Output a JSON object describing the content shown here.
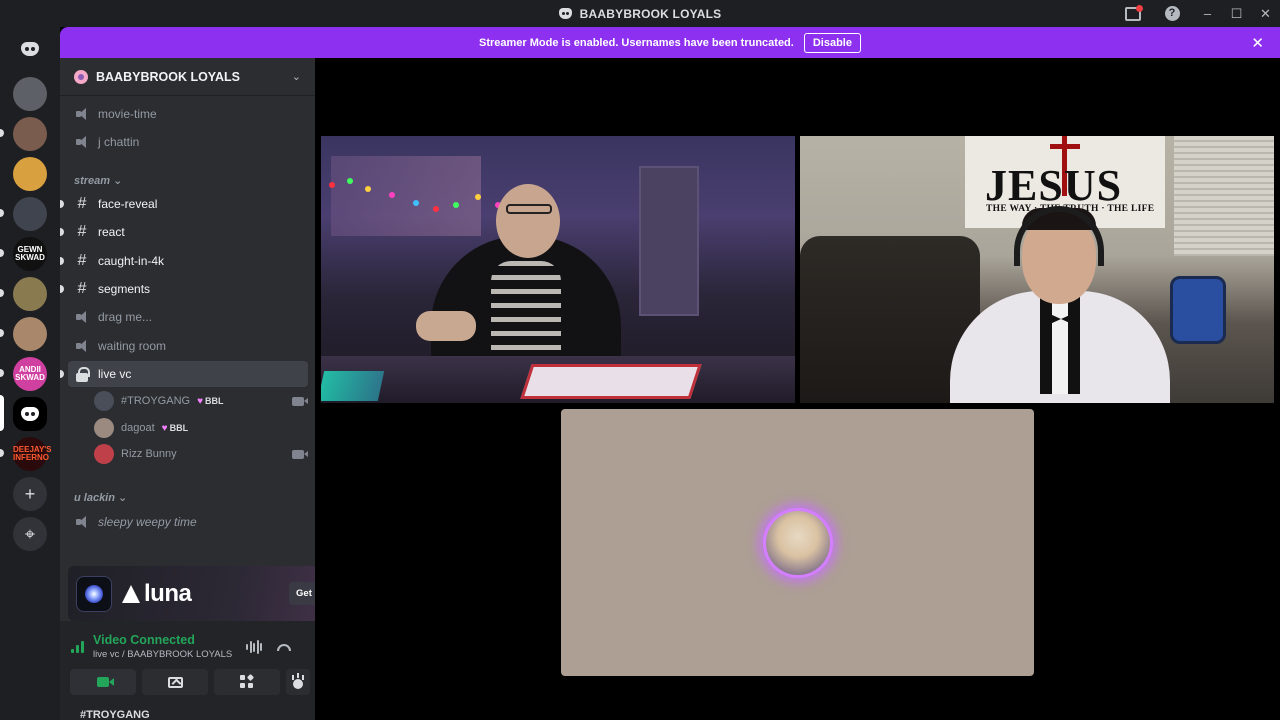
{
  "window": {
    "title": "BAABYBROOK LOYALS",
    "controls": {
      "minimize": "–",
      "maximize": "☐",
      "close": "✕"
    },
    "help_icon": "?"
  },
  "banner": {
    "text": "Streamer Mode is enabled. Usernames have been truncated.",
    "button": "Disable",
    "close": "✕"
  },
  "rail": {
    "servers": [
      {
        "name": "server-1",
        "color": "#5d6066"
      },
      {
        "name": "server-2",
        "color": "#7a5c4e"
      },
      {
        "name": "server-3",
        "color": "#d9a040"
      },
      {
        "name": "server-4",
        "color": "#40444e"
      },
      {
        "name": "server-5",
        "color": "#111111",
        "label": "GEWN SKWAD"
      },
      {
        "name": "server-6",
        "color": "#8a7a50"
      },
      {
        "name": "server-7",
        "color": "#a8876a"
      },
      {
        "name": "server-8",
        "color": "#d040a0",
        "label": "ANDII SKWAD"
      },
      {
        "name": "server-9",
        "color": "#000000"
      },
      {
        "name": "server-10",
        "color": "#2a0a0a",
        "label": "DEEJAY'S INFERNO"
      }
    ],
    "add": "+",
    "explore": "⌖"
  },
  "sidebar": {
    "guild_name": "BAABYBROOK LOYALS",
    "channels_top": [
      {
        "name": "movie-time",
        "type": "voice"
      },
      {
        "name": "j chattin",
        "type": "voice"
      }
    ],
    "category_stream": "stream",
    "stream_channels": [
      {
        "name": "face-reveal",
        "type": "text",
        "unread": true
      },
      {
        "name": "react",
        "type": "text",
        "unread": true
      },
      {
        "name": "caught-in-4k",
        "type": "text",
        "unread": true
      },
      {
        "name": "segments",
        "type": "text",
        "unread": true
      },
      {
        "name": "drag me...",
        "type": "voice"
      },
      {
        "name": "waiting room",
        "type": "voice"
      },
      {
        "name": "live vc",
        "type": "locked-voice"
      }
    ],
    "voice_users": [
      {
        "name": "#TROYGANG",
        "tag": "BBL",
        "avatar_color": "#4a4e58"
      },
      {
        "name": "dagoat",
        "tag": "BBL",
        "avatar_color": "#9a8a80"
      },
      {
        "name": "Rizz Bunny",
        "tag": "",
        "avatar_color": "#c0404a"
      }
    ],
    "category_lackin": "u lackin",
    "lackin_channels": [
      {
        "name": "sleepy weepy time",
        "type": "voice"
      }
    ]
  },
  "promo": {
    "brand": "luna",
    "button": "Get Reward!"
  },
  "voice_panel": {
    "status": "Video Connected",
    "location": "live vc / BAABYBROOK LOYALS",
    "user_peek": "#TROYGANG"
  }
}
